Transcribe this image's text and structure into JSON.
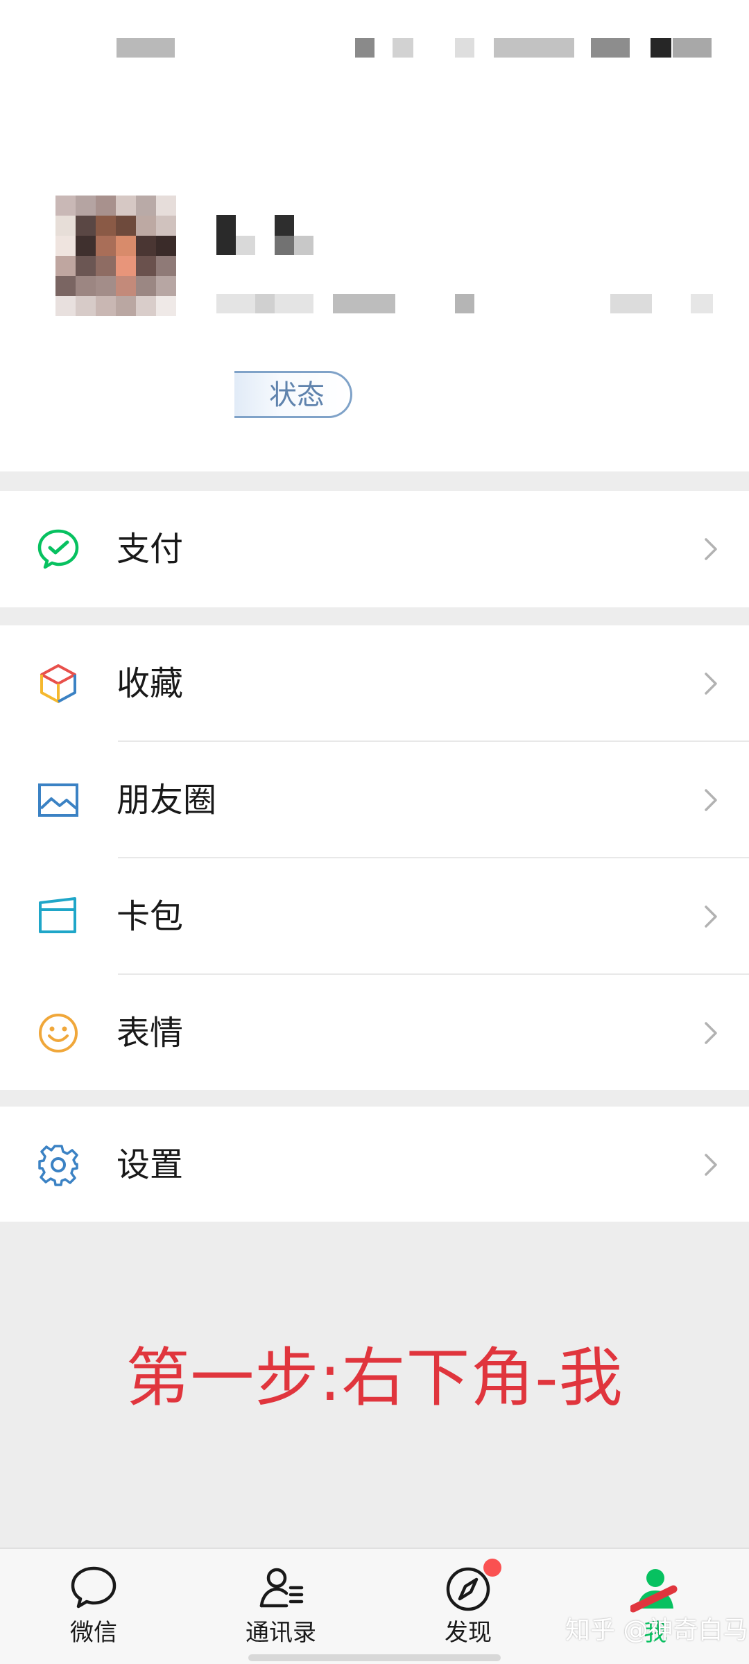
{
  "profile": {
    "status_label": "状态"
  },
  "menu": {
    "pay": {
      "label": "支付",
      "icon": "wechat-pay-icon"
    },
    "favorites": {
      "label": "收藏",
      "icon": "favorites-cube-icon"
    },
    "moments": {
      "label": "朋友圈",
      "icon": "moments-image-icon"
    },
    "cards": {
      "label": "卡包",
      "icon": "card-wallet-icon"
    },
    "stickers": {
      "label": "表情",
      "icon": "smiley-icon"
    },
    "settings": {
      "label": "设置",
      "icon": "gear-icon"
    }
  },
  "annotation": {
    "text": "第一步:右下角-我"
  },
  "tabbar": {
    "items": [
      {
        "label": "微信",
        "icon": "chat-bubble-icon"
      },
      {
        "label": "通讯录",
        "icon": "contacts-icon"
      },
      {
        "label": "发现",
        "icon": "compass-icon"
      },
      {
        "label": "我",
        "icon": "me-person-icon"
      }
    ]
  },
  "watermark": "知乎 @神奇白马",
  "colors": {
    "accent_green": "#07c160",
    "annotation_red": "#e0353d",
    "badge_red": "#fa5151",
    "icon_blue": "#3b82c4"
  }
}
